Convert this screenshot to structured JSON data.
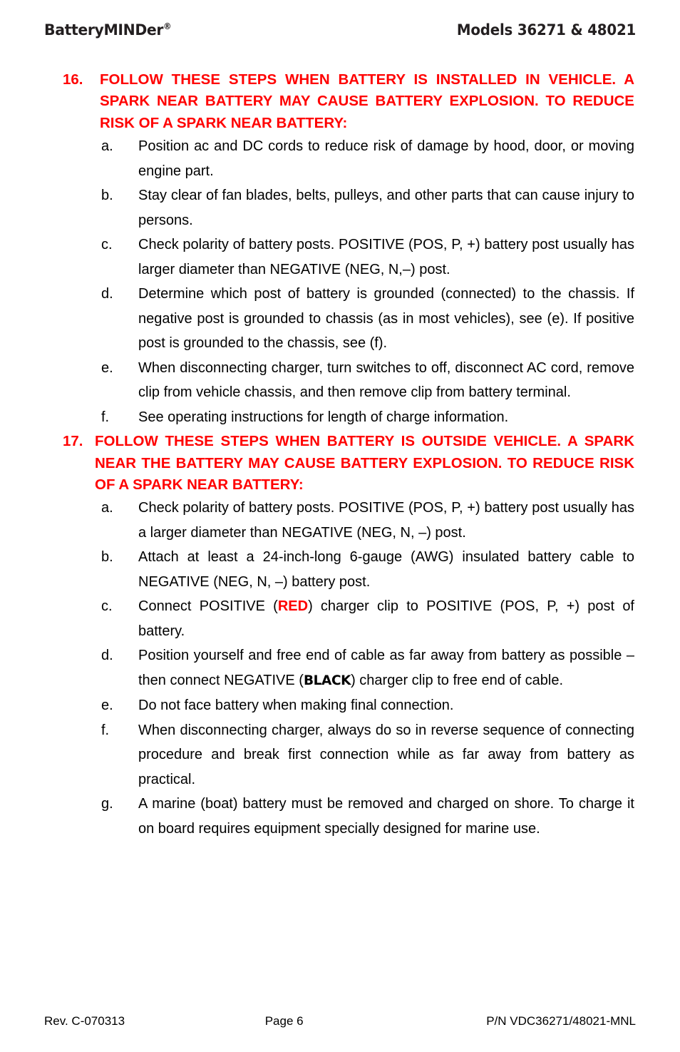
{
  "header": {
    "brand": "BatteryMINDer",
    "brand_registered": "®",
    "models": "Models 36271 & 48021"
  },
  "sections": [
    {
      "number": "16.",
      "heading": "FOLLOW THESE STEPS WHEN BATTERY IS INSTALLED IN VEHICLE.  A SPARK NEAR BATTERY MAY CAUSE BATTERY EXPLOSION.  TO REDUCE RISK OF A SPARK NEAR BATTERY:",
      "heading_color": "#ff0000",
      "items": [
        {
          "marker": "a.",
          "text": "Position ac and DC cords to reduce risk of damage by hood, door, or moving engine part."
        },
        {
          "marker": "b.",
          "text": "Stay clear of fan blades, belts, pulleys, and other parts that can cause injury to persons."
        },
        {
          "marker": "c.",
          "text": "Check polarity of battery posts.  POSITIVE (POS, P, +) battery post usually has larger diameter than NEGATIVE (NEG, N,–) post."
        },
        {
          "marker": "d.",
          "text": "Determine which post of battery is grounded (connected) to the chassis.  If negative post is grounded to chassis (as in most vehicles), see (e).  If positive post is grounded to the chassis, see (f)."
        },
        {
          "marker": "e.",
          "text": "When disconnecting charger, turn switches to off, disconnect AC cord, remove clip from vehicle chassis, and then remove clip from battery terminal."
        },
        {
          "marker": "f.",
          "text": "See operating instructions for length of charge information."
        }
      ]
    },
    {
      "number": "17.",
      "heading": "FOLLOW THESE STEPS WHEN BATTERY IS OUTSIDE VEHICLE.  A SPARK NEAR THE BATTERY MAY CAUSE BATTERY EXPLOSION.  TO REDUCE RISK OF A SPARK NEAR BATTERY:",
      "heading_color": "#ff0000",
      "items": [
        {
          "marker": "a.",
          "text": "Check polarity of battery posts.  POSITIVE (POS, P, +) battery post usually has a larger diameter than NEGATIVE (NEG, N, –) post."
        },
        {
          "marker": "b.",
          "text": "Attach at least a 24-inch-long 6-gauge (AWG) insulated battery cable to NEGATIVE (NEG, N, –) battery post."
        },
        {
          "marker": "c.",
          "text_before": "Connect POSITIVE (",
          "highlight": "RED",
          "highlight_color": "#ff0000",
          "text_after": ") charger clip to POSITIVE (POS, P, +) post of battery."
        },
        {
          "marker": "d.",
          "text_before": "Position yourself and free end of cable as far away from battery as possible – then connect NEGATIVE (",
          "highlight": "BLACK",
          "highlight_color": "#000000",
          "text_after": ") charger clip to free end of cable."
        },
        {
          "marker": "e.",
          "text": "Do not face battery when making final connection."
        },
        {
          "marker": "f.",
          "text": "When disconnecting charger, always do so in reverse sequence of connecting procedure and break first connection while as far away from battery as practical."
        },
        {
          "marker": "g.",
          "text": "A marine (boat) battery must be removed and charged on shore. To charge it on board requires equipment specially designed for marine use."
        }
      ]
    }
  ],
  "footer": {
    "revision": "Rev. C-070313",
    "page": "Page 6",
    "part_number": "P/N VDC36271/48021-MNL"
  }
}
